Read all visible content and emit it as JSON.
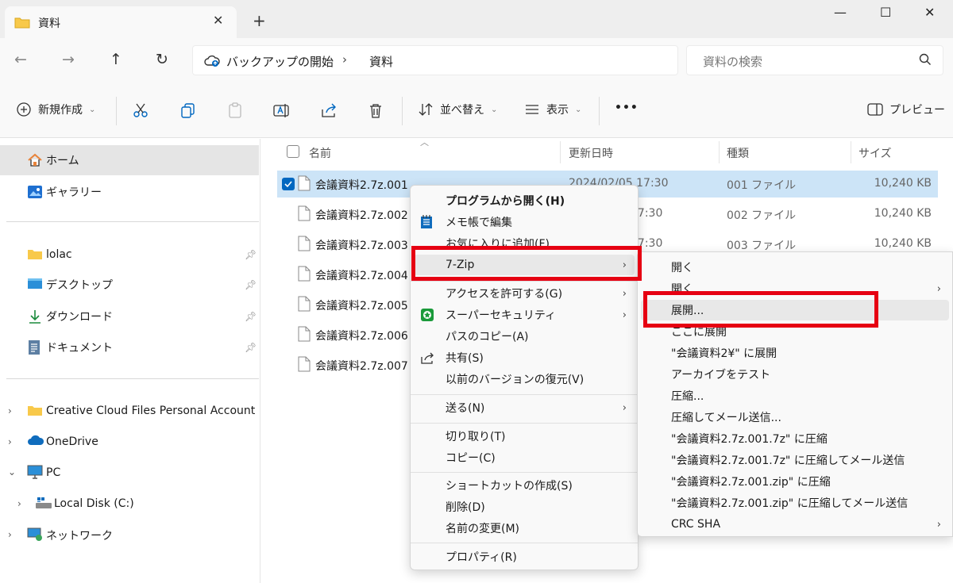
{
  "window": {
    "tab_title": "資料",
    "new_tab": "+",
    "minimize": "—",
    "maximize": "☐",
    "close": "✕"
  },
  "nav": {
    "back": "←",
    "forward": "→",
    "up": "↑",
    "refresh": "↻",
    "breadcrumb": [
      "バックアップの開始",
      "資料"
    ],
    "breadcrumb_sep": "›",
    "search_placeholder": "資料の検索"
  },
  "commandbar": {
    "new_label": "新規作成",
    "sort_label": "並べ替え",
    "view_label": "表示",
    "more_label": "•••",
    "preview_label": "プレビュー"
  },
  "sidebar": {
    "home": "ホーム",
    "gallery": "ギャラリー",
    "pinned": [
      {
        "label": "lolac"
      },
      {
        "label": "デスクトップ"
      },
      {
        "label": "ダウンロード"
      },
      {
        "label": "ドキュメント"
      }
    ],
    "tree": [
      {
        "label": "Creative Cloud Files Personal Account rin",
        "expander": "›"
      },
      {
        "label": "OneDrive",
        "expander": "›"
      },
      {
        "label": "PC",
        "expander": "⌄"
      },
      {
        "label": "Local Disk (C:)",
        "expander": "›"
      },
      {
        "label": "ネットワーク",
        "expander": "›"
      }
    ]
  },
  "filelist": {
    "columns": [
      "名前",
      "更新日時",
      "種類",
      "サイズ"
    ],
    "rows": [
      {
        "name": "会議資料2.7z.001",
        "date": "2024/02/05 17:30",
        "type": "001 ファイル",
        "size": "10,240 KB"
      },
      {
        "name": "会議資料2.7z.002",
        "date": "17:30",
        "type": "002 ファイル",
        "size": "10,240 KB"
      },
      {
        "name": "会議資料2.7z.003",
        "date": "17:30",
        "type": "003 ファイル",
        "size": "10,240 KB"
      },
      {
        "name": "会議資料2.7z.004",
        "date": "",
        "type": "",
        "size": ""
      },
      {
        "name": "会議資料2.7z.005",
        "date": "",
        "type": "",
        "size": ""
      },
      {
        "name": "会議資料2.7z.006",
        "date": "",
        "type": "",
        "size": ""
      },
      {
        "name": "会議資料2.7z.007",
        "date": "",
        "type": "",
        "size": ""
      }
    ]
  },
  "context_menu": {
    "items": [
      "プログラムから開く(H)",
      "メモ帳で編集",
      "お気に入りに追加(F)",
      "7-Zip",
      "アクセスを許可する(G)",
      "スーパーセキュリティ",
      "パスのコピー(A)",
      "共有(S)",
      "以前のバージョンの復元(V)",
      "送る(N)",
      "切り取り(T)",
      "コピー(C)",
      "ショートカットの作成(S)",
      "削除(D)",
      "名前の変更(M)",
      "プロパティ(R)"
    ],
    "arrow": "›"
  },
  "submenu_7zip": {
    "items": [
      "開く",
      "開く",
      "展開...",
      "ここに展開",
      "\"会議資料2¥\" に展開",
      "アーカイブをテスト",
      "圧縮...",
      "圧縮してメール送信...",
      "\"会議資料2.7z.001.7z\" に圧縮",
      "\"会議資料2.7z.001.7z\" に圧縮してメール送信",
      "\"会議資料2.7z.001.zip\" に圧縮",
      "\"会議資料2.7z.001.zip\" に圧縮してメール送信",
      "CRC SHA"
    ],
    "arrow": "›"
  },
  "colors": {
    "highlight_red": "#e60012",
    "selection_blue": "#cce4f7",
    "accent": "#0067c0"
  }
}
